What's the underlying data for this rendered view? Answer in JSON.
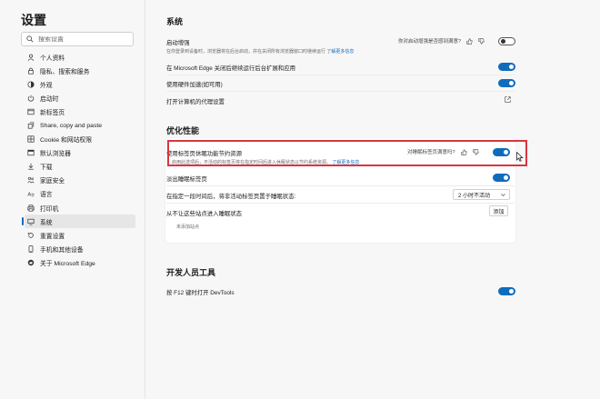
{
  "sidebar": {
    "title": "设置",
    "search_placeholder": "搜索设置",
    "items": [
      {
        "label": "个人资料",
        "icon": "profile-icon"
      },
      {
        "label": "隐私、搜索和服务",
        "icon": "lock-icon"
      },
      {
        "label": "外观",
        "icon": "appearance-icon"
      },
      {
        "label": "启动时",
        "icon": "power-icon"
      },
      {
        "label": "新标签页",
        "icon": "new-tab-icon"
      },
      {
        "label": "Share, copy and paste",
        "icon": "share-icon"
      },
      {
        "label": "Cookie 和网站权限",
        "icon": "cookie-icon"
      },
      {
        "label": "默认浏览器",
        "icon": "browser-icon"
      },
      {
        "label": "下载",
        "icon": "download-icon"
      },
      {
        "label": "家庭安全",
        "icon": "family-icon"
      },
      {
        "label": "语言",
        "icon": "language-icon"
      },
      {
        "label": "打印机",
        "icon": "printer-icon"
      },
      {
        "label": "系统",
        "icon": "system-icon",
        "active": true
      },
      {
        "label": "重置设置",
        "icon": "reset-icon"
      },
      {
        "label": "手机和其他设备",
        "icon": "phone-icon"
      },
      {
        "label": "关于 Microsoft Edge",
        "icon": "edge-icon"
      }
    ]
  },
  "system": {
    "title": "系统",
    "startup_boost": {
      "label": "启动增强",
      "desc": "在你登录到设备时，浏览器将在后台启动，并在关闭所有浏览器窗口时继续运行",
      "link": "了解更多信息",
      "feedback": "你对启动增强是否感到满意?",
      "enabled": false
    },
    "background_apps": {
      "label": "在 Microsoft Edge 关闭后继续运行后台扩展和应用",
      "enabled": true
    },
    "hardware_accel": {
      "label": "使用硬件加速(如可用)",
      "enabled": true
    },
    "proxy": {
      "label": "打开计算机的代理设置"
    }
  },
  "optimize": {
    "title": "优化性能",
    "sleeping_tabs": {
      "label": "使用标签页休眠功能节约资源",
      "desc": "启用此选项后，不活动的标签页将在指定时间后进入休眠状态以节约系统资源。",
      "link": "了解更多信息",
      "feedback": "对睡眠标签页满意吗?",
      "enabled": true
    },
    "fade_tabs": {
      "label": "淡出睡眠标签页",
      "enabled": true
    },
    "inactive_after": {
      "label": "在指定一段时间后，将非活动标签页置于睡眠状态:",
      "value": "2 小时不活动"
    },
    "never_sleep": {
      "label": "从不让这些站点进入睡眠状态",
      "button": "添加",
      "empty": "未添加站点"
    }
  },
  "devtools": {
    "title": "开发人员工具",
    "f12": {
      "label": "按 F12 键时打开 DevTools",
      "enabled": true
    }
  },
  "colors": {
    "accent": "#0f6cbd",
    "highlight": "#d9363e"
  }
}
